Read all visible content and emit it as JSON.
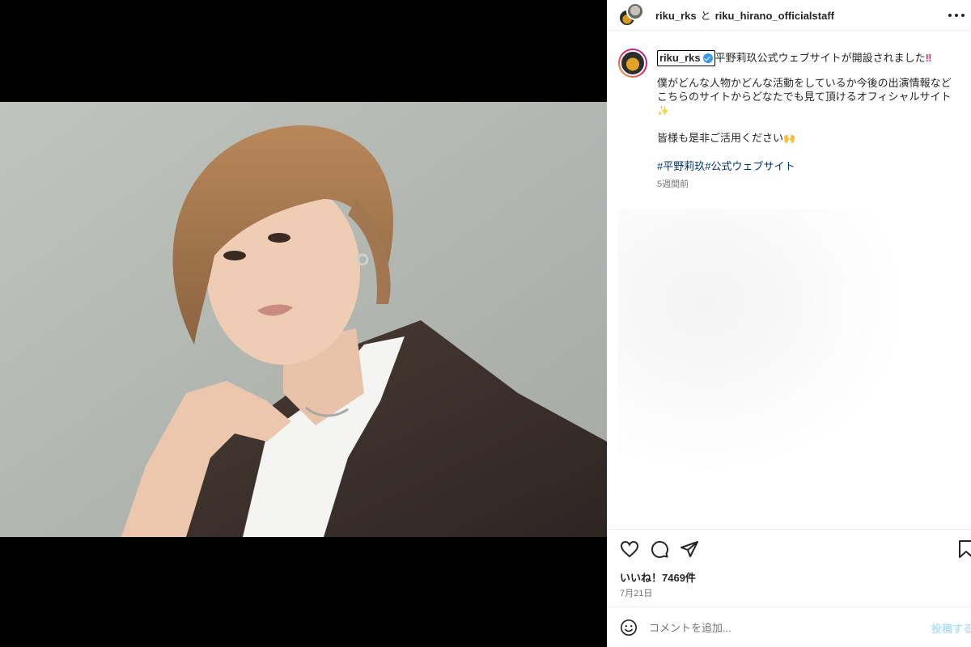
{
  "post": {
    "header": {
      "user1": "riku_rks",
      "separator": "と",
      "user2": "riku_hirano_officialstaff"
    },
    "caption": {
      "username": "riku_rks",
      "line1": "平野莉玖公式ウェブサイトが開設されました",
      "line1_mark": "‼",
      "para2_a": "僕がどんな人物かどんな活動をしているか今後の出演情報など",
      "para2_b": "こちらのサイトからどなたでも見て頂けるオフィシャルサイト",
      "sparkle": "✨",
      "para3": "皆様も是非ご活用ください",
      "hands": "🙌",
      "tag1": "#平野莉玖",
      "tag2": "#公式ウェブサイト",
      "time_ago": "5週間前"
    },
    "likes": "いいね！7469件",
    "date": "7月21日",
    "comment": {
      "placeholder": "コメントを追加...",
      "post_label": "投稿する"
    }
  },
  "icons": {
    "like": "heart-icon",
    "comment": "comment-icon",
    "share": "paper-plane-icon",
    "save": "bookmark-icon",
    "emoji": "smiley-icon",
    "more": "more-options-icon"
  }
}
